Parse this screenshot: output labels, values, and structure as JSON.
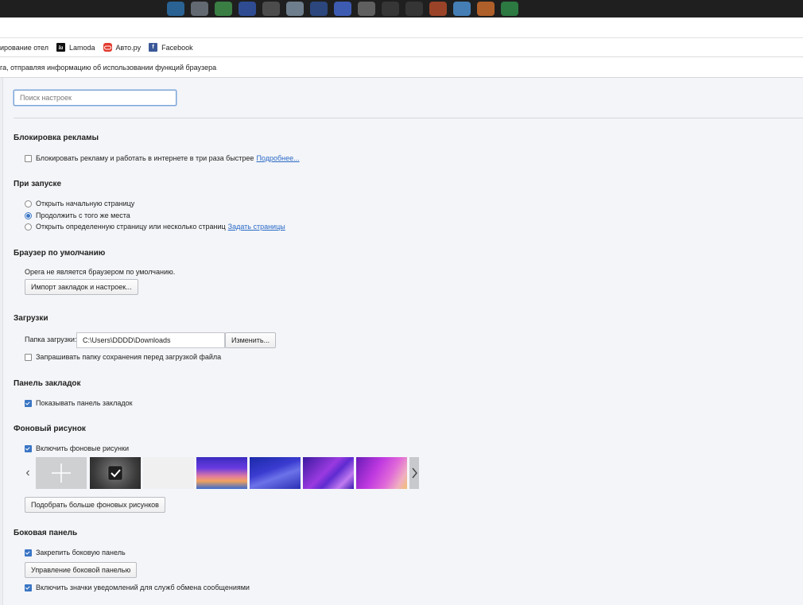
{
  "bookmarks": {
    "items": [
      {
        "label": "ирование отел",
        "icon": "hotel-icon"
      },
      {
        "label": "Lamoda",
        "icon": "lamoda-icon",
        "icon_text": "la"
      },
      {
        "label": "Авто.ру",
        "icon": "autoru-icon"
      },
      {
        "label": "Facebook",
        "icon": "facebook-icon",
        "icon_text": "f"
      }
    ]
  },
  "infobar": {
    "text": "га, отправляя информацию об использовании функций браузера"
  },
  "search": {
    "placeholder": "Поиск настроек"
  },
  "adblock": {
    "heading": "Блокировка рекламы",
    "checkbox_label": "Блокировать рекламу и работать в интернете в три раза быстрее",
    "checked": false,
    "link": "Подробнее..."
  },
  "startup": {
    "heading": "При запуске",
    "options": [
      {
        "label": "Открыть начальную страницу",
        "selected": false
      },
      {
        "label": "Продолжить с того же места",
        "selected": true
      },
      {
        "label": "Открыть определенную страницу или несколько страниц",
        "selected": false
      }
    ],
    "link": "Задать страницы"
  },
  "default_browser": {
    "heading": "Браузер по умолчанию",
    "status": "Opera не является браузером по умолчанию.",
    "import_button": "Импорт закладок и настроек..."
  },
  "downloads": {
    "heading": "Загрузки",
    "folder_label": "Папка загрузки:",
    "folder_value": "C:\\Users\\DDDD\\Downloads",
    "change_button": "Изменить...",
    "ask_label": "Запрашивать папку сохранения перед загрузкой файла",
    "ask_checked": false
  },
  "bookmarks_bar": {
    "heading": "Панель закладок",
    "show_label": "Показывать панель закладок",
    "show_checked": true
  },
  "wallpaper": {
    "heading": "Фоновый рисунок",
    "enable_label": "Включить фоновые рисунки",
    "enable_checked": true,
    "more_button": "Подобрать больше фоновых рисунков"
  },
  "sidebar": {
    "heading": "Боковая панель",
    "pin_label": "Закрепить боковую панель",
    "pin_checked": true,
    "manage_button": "Управление боковой панелью",
    "notify_label": "Включить значки уведомлений для служб обмена сообщениями",
    "notify_checked": true
  },
  "colors": {
    "accent": "#3a75c4",
    "link": "#2a6ac8",
    "page_bg": "#f4f5f8"
  }
}
